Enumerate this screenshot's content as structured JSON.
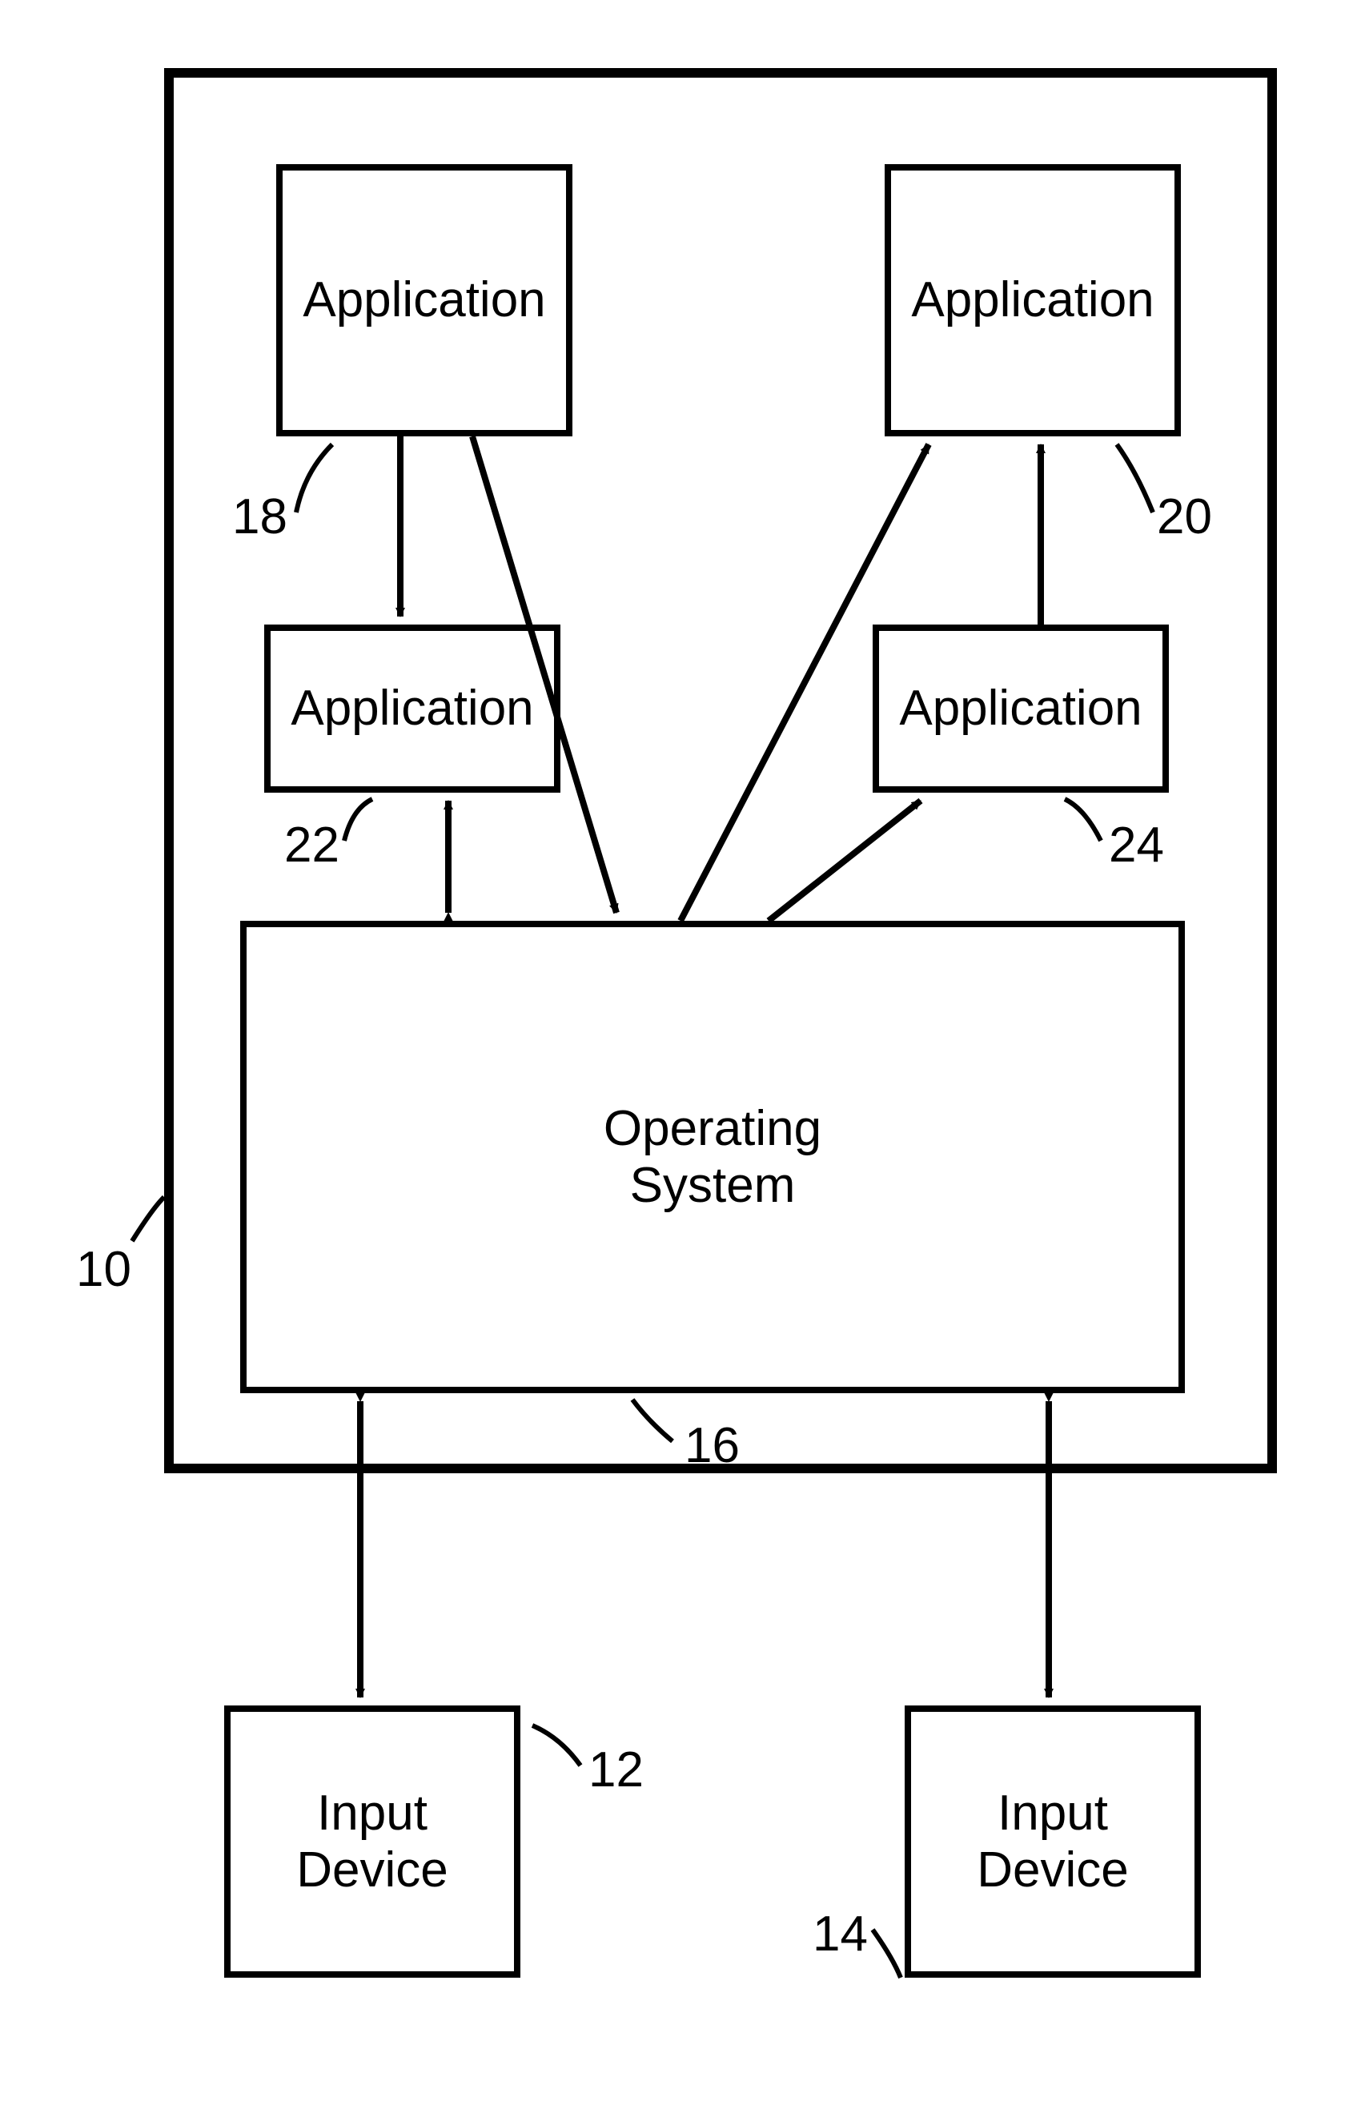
{
  "boxes": {
    "app18": "Application",
    "app20": "Application",
    "app22": "Application",
    "app24": "Application",
    "os": "Operating\nSystem",
    "inp12": "Input\nDevice",
    "inp14": "Input\nDevice"
  },
  "refs": {
    "r10": "10",
    "r12": "12",
    "r14": "14",
    "r16": "16",
    "r18": "18",
    "r20": "20",
    "r22": "22",
    "r24": "24"
  }
}
